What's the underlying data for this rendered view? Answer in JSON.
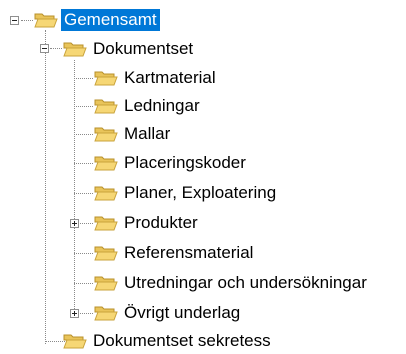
{
  "tree": {
    "root": {
      "label": "Gemensamt",
      "expanded": true,
      "selected": true
    },
    "dokumentset": {
      "label": "Dokumentset",
      "expanded": true
    },
    "children": [
      {
        "label": "Kartmaterial",
        "has_children": false
      },
      {
        "label": "Ledningar",
        "has_children": false
      },
      {
        "label": "Mallar",
        "has_children": false
      },
      {
        "label": "Placeringskoder",
        "has_children": false
      },
      {
        "label": "Planer, Exploatering",
        "has_children": false
      },
      {
        "label": "Produkter",
        "has_children": true,
        "expanded": false
      },
      {
        "label": "Referensmaterial",
        "has_children": false
      },
      {
        "label": "Utredningar och undersökningar",
        "has_children": false
      },
      {
        "label": "Övrigt underlag",
        "has_children": true,
        "expanded": false
      }
    ],
    "dokumentset_sekretess": {
      "label": "Dokumentset sekretess",
      "has_children": false
    }
  },
  "icons": {
    "folder": "folder-icon",
    "expand": "plus-icon",
    "collapse": "minus-icon"
  },
  "colors": {
    "selection": "#0078d7",
    "folder_fill": "#f6d775",
    "folder_edge": "#c9a33b"
  }
}
